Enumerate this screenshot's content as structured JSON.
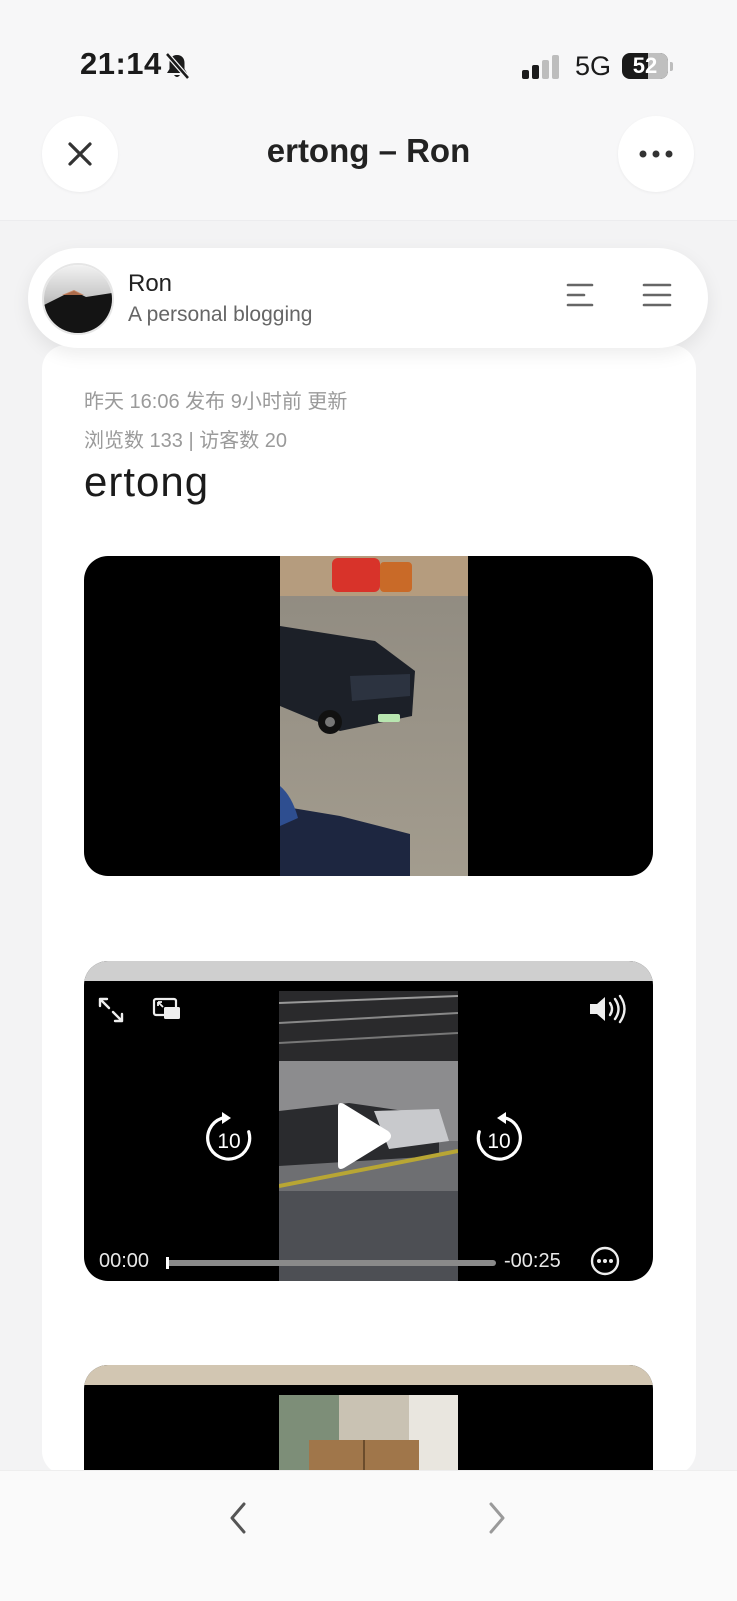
{
  "status": {
    "time": "21:14",
    "network": "5G",
    "battery": "52"
  },
  "header": {
    "title": "ertong – Ron"
  },
  "blog": {
    "name": "Ron",
    "description": "A personal blogging"
  },
  "post": {
    "meta_dates": "昨天 16:06 发布 9小时前 更新",
    "meta_stats": "浏览数 133 | 访客数 20",
    "title": "ertong"
  },
  "video2": {
    "elapsed": "00:00",
    "remaining": "-00:25",
    "progress": 0.0,
    "skip_seconds": "10"
  },
  "icons": {
    "status": [
      "bell-off-icon",
      "signal-icon",
      "battery-icon"
    ],
    "header": [
      "close-icon",
      "more-icon"
    ],
    "blog_bar": [
      "avatar",
      "toc-icon",
      "menu-icon"
    ],
    "video_controls": [
      "fullscreen-icon",
      "pip-icon",
      "volume-icon",
      "rewind-10-icon",
      "play-icon",
      "forward-10-icon",
      "options-icon"
    ],
    "nav": [
      "chevron-left-icon",
      "chevron-right-icon"
    ]
  },
  "colors": {
    "page_bg": "#f3f3f4",
    "card_bg": "#ffffff",
    "meta_text": "#9a9a9a",
    "video_bg": "#000000"
  }
}
